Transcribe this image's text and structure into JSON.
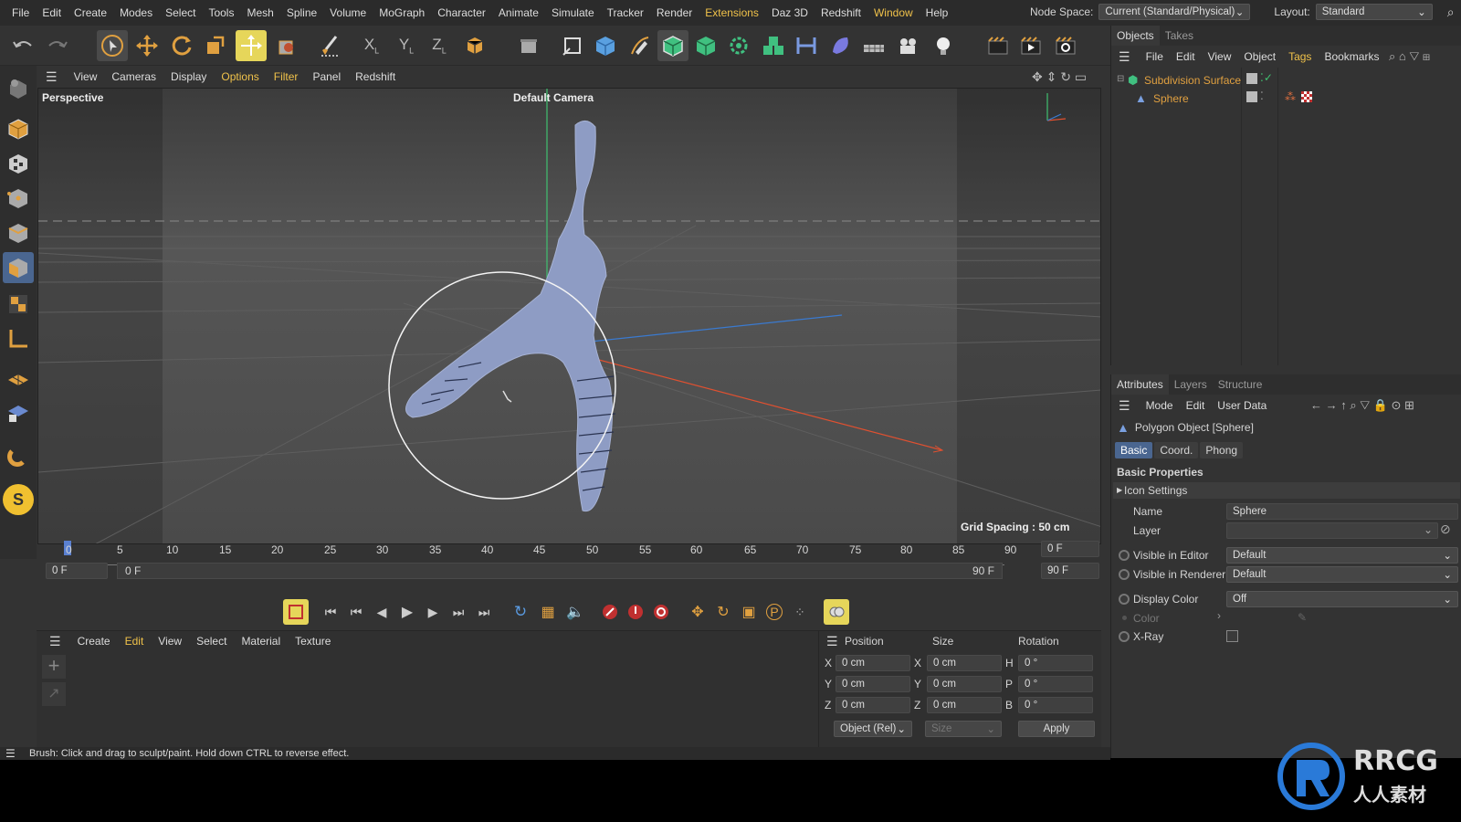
{
  "menubar": {
    "items": [
      "File",
      "Edit",
      "Create",
      "Modes",
      "Select",
      "Tools",
      "Mesh",
      "Spline",
      "Volume",
      "MoGraph",
      "Character",
      "Animate",
      "Simulate",
      "Tracker",
      "Render",
      "Extensions",
      "Daz 3D",
      "Redshift",
      "Window",
      "Help"
    ],
    "node_space_label": "Node Space:",
    "node_space_value": "Current (Standard/Physical)",
    "layout_label": "Layout:",
    "layout_value": "Standard"
  },
  "viewport_menu": {
    "items": [
      "View",
      "Cameras",
      "Display",
      "Options",
      "Filter",
      "Panel",
      "Redshift"
    ]
  },
  "viewport": {
    "view_name": "Perspective",
    "camera": "Default Camera",
    "grid_spacing": "Grid Spacing : 50 cm"
  },
  "timeline": {
    "ticks": [
      "0",
      "5",
      "10",
      "15",
      "20",
      "25",
      "30",
      "35",
      "40",
      "45",
      "50",
      "55",
      "60",
      "65",
      "70",
      "75",
      "80",
      "85",
      "90"
    ],
    "current_frame": "0 F",
    "start_frame": "0 F",
    "range_start": "0 F",
    "range_end": "90 F",
    "end_frame": "90 F",
    "end_frame2": "90 F"
  },
  "material_menu": {
    "items": [
      "Create",
      "Edit",
      "View",
      "Select",
      "Material",
      "Texture"
    ]
  },
  "coords": {
    "headers": [
      "Position",
      "Size",
      "Rotation"
    ],
    "rows": [
      {
        "axis": "X",
        "pos": "0 cm",
        "size_axis": "X",
        "size": "0 cm",
        "rot_axis": "H",
        "rot": "0 °"
      },
      {
        "axis": "Y",
        "pos": "0 cm",
        "size_axis": "Y",
        "size": "0 cm",
        "rot_axis": "P",
        "rot": "0 °"
      },
      {
        "axis": "Z",
        "pos": "0 cm",
        "size_axis": "Z",
        "size": "0 cm",
        "rot_axis": "B",
        "rot": "0 °"
      }
    ],
    "mode_select": "Object (Rel)",
    "size_select": "Size",
    "apply_label": "Apply"
  },
  "status": "Brush: Click and drag to sculpt/paint. Hold down CTRL to reverse effect.",
  "objects_panel": {
    "tabs": [
      "Objects",
      "Takes"
    ],
    "menu": [
      "File",
      "Edit",
      "View",
      "Object",
      "Tags",
      "Bookmarks"
    ],
    "objects": [
      {
        "name": "Subdivision Surface",
        "color": "#e0a040"
      },
      {
        "name": "Sphere",
        "color": "#e0a040"
      }
    ]
  },
  "attributes_panel": {
    "tabs": [
      "Attributes",
      "Layers",
      "Structure"
    ],
    "menu": [
      "Mode",
      "Edit",
      "User Data"
    ],
    "object_title": "Polygon Object [Sphere]",
    "subtabs": [
      "Basic",
      "Coord.",
      "Phong"
    ],
    "section": "Basic Properties",
    "icon_settings": "Icon Settings",
    "props": {
      "name_label": "Name",
      "name_value": "Sphere",
      "layer_label": "Layer",
      "vis_editor_label": "Visible in Editor",
      "vis_editor_value": "Default",
      "vis_render_label": "Visible in Renderer",
      "vis_render_value": "Default",
      "display_color_label": "Display Color",
      "display_color_value": "Off",
      "color_label": "Color",
      "xray_label": "X-Ray"
    }
  },
  "watermark": {
    "brand": "RRCG",
    "sub": "人人素材"
  },
  "colors": {
    "accent": "#f0c24a",
    "selection_blue": "#4a6690",
    "axis_x": "#e05030",
    "axis_y": "#40c070",
    "axis_z": "#3a7ad0"
  }
}
